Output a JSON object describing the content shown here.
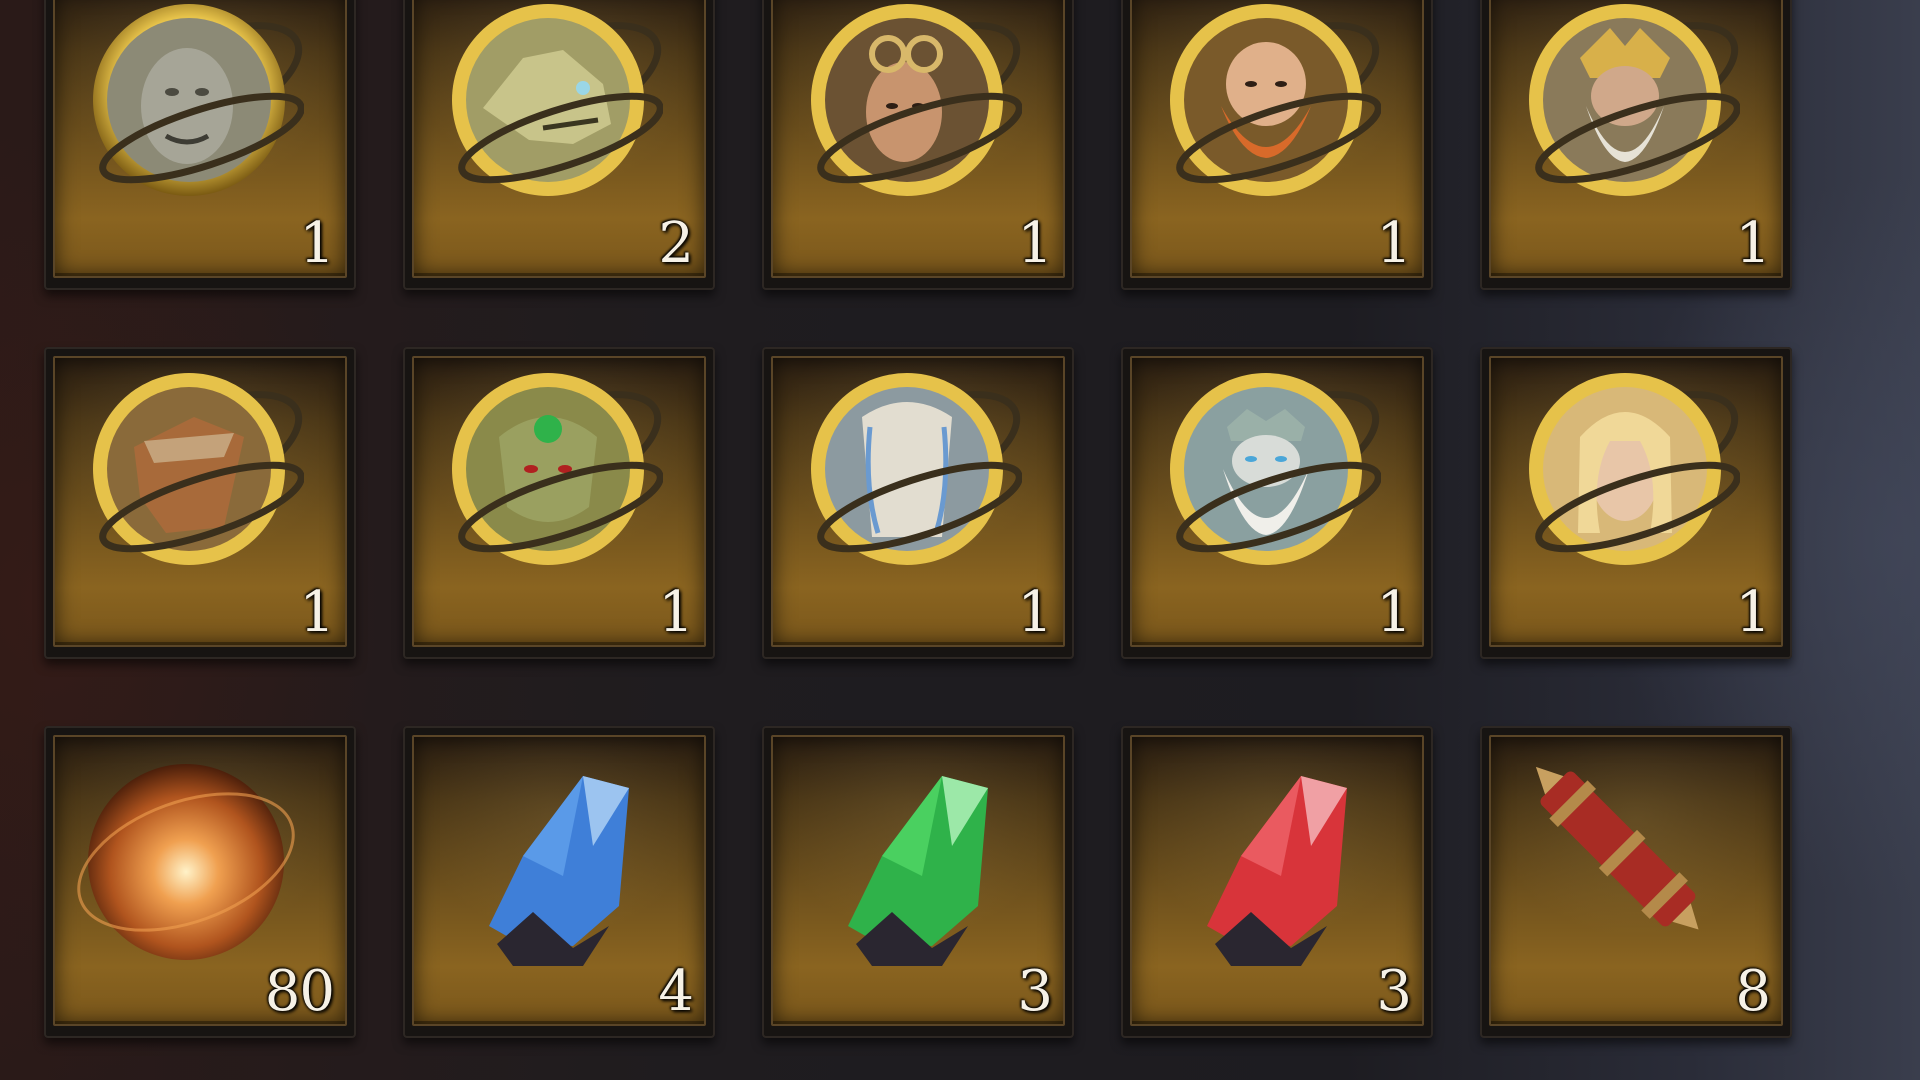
{
  "inventory": {
    "rows": [
      [
        {
          "name": "orc-hero-medallion-icon",
          "count": "1"
        },
        {
          "name": "dragon-hero-medallion-icon",
          "count": "2"
        },
        {
          "name": "goggles-heroine-medallion-icon",
          "count": "1"
        },
        {
          "name": "dwarf-hero-medallion-icon",
          "count": "1"
        },
        {
          "name": "horned-king-medallion-icon",
          "count": "1"
        }
      ],
      [
        {
          "name": "horse-hero-medallion-icon",
          "count": "1"
        },
        {
          "name": "goblin-hero-medallion-icon",
          "count": "1"
        },
        {
          "name": "veiled-spirit-medallion-icon",
          "count": "1"
        },
        {
          "name": "frost-king-medallion-icon",
          "count": "1"
        },
        {
          "name": "blonde-heroine-medallion-icon",
          "count": "1"
        }
      ],
      [
        {
          "name": "fire-orb-icon",
          "count": "80"
        },
        {
          "name": "blue-crystal-icon",
          "count": "4"
        },
        {
          "name": "green-crystal-icon",
          "count": "3"
        },
        {
          "name": "red-crystal-icon",
          "count": "3"
        },
        {
          "name": "red-scroll-case-icon",
          "count": "8"
        }
      ]
    ]
  },
  "colors": {
    "gold": "#e6c24a",
    "blue_crystal": "#3f7fd8",
    "green_crystal": "#2fb24a",
    "red_crystal": "#d8343a",
    "orb": "#e08a3a"
  }
}
